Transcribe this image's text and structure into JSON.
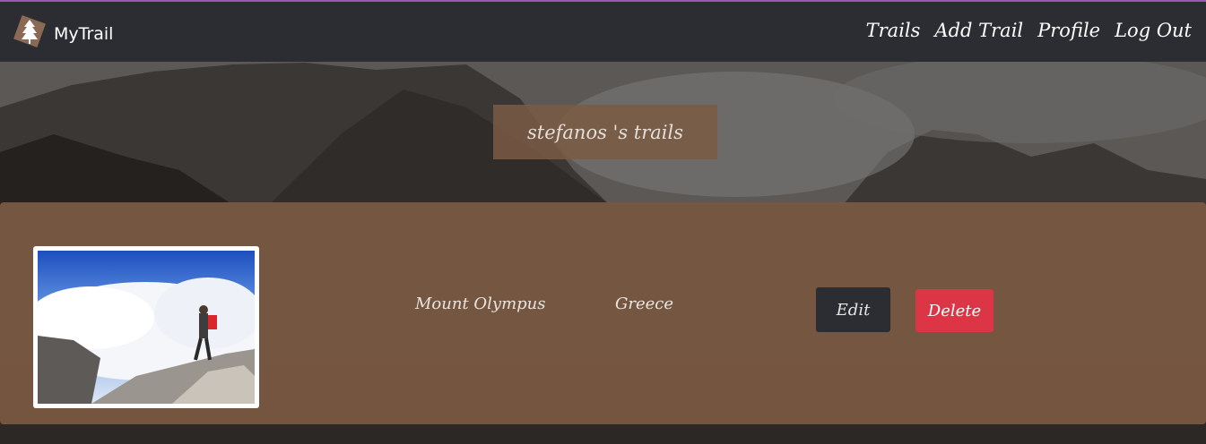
{
  "navbar": {
    "brand": "MyTrail",
    "links": [
      "Trails",
      "Add Trail",
      "Profile",
      "Log Out"
    ]
  },
  "page_title": "stefanos 's trails",
  "trails": [
    {
      "name": "Mount Olympus",
      "country": "Greece",
      "edit_label": "Edit",
      "delete_label": "Delete"
    }
  ],
  "colors": {
    "navbar": "#2c2d32",
    "accent_line": "#9b59b6",
    "card": "#795842",
    "delete": "#dc3545"
  }
}
